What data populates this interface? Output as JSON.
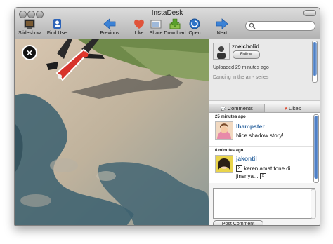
{
  "window": {
    "title": "InstaDesk"
  },
  "toolbar": {
    "buttons": [
      {
        "label": "Slideshow",
        "icon": "slideshow-icon"
      },
      {
        "label": "Find User",
        "icon": "find-user-icon"
      },
      {
        "label": "Previous",
        "icon": "previous-arrow-icon"
      },
      {
        "label": "Like",
        "icon": "heart-icon"
      },
      {
        "label": "Share",
        "icon": "share-icon"
      },
      {
        "label": "Download",
        "icon": "download-icon"
      },
      {
        "label": "Open",
        "icon": "open-icon"
      },
      {
        "label": "Next",
        "icon": "next-arrow-icon"
      }
    ],
    "search": {
      "icon": "search-icon",
      "value": ""
    }
  },
  "photo": {
    "close_icon": "close-icon"
  },
  "info": {
    "username": "zoelcholid",
    "follow_label": "Follow",
    "uploaded": "Uploaded 29 minutes ago",
    "caption": "Dancing in the air - series"
  },
  "tabs": {
    "comments": "Comments",
    "likes": "Likes"
  },
  "comments": [
    {
      "time": "25 minutes ago",
      "user": "lhampster",
      "text": "Nice shadow story!"
    },
    {
      "time": "6 minutes ago",
      "user": "jakontil",
      "text_before": "keren amat tone di jinsnya...",
      "box_glyph": "X"
    }
  ],
  "compose": {
    "value": "",
    "post_label": "Post Comment"
  },
  "colors": {
    "link": "#3a6ea5",
    "accent_blue": "#3f76c4",
    "like_red": "#e0533a"
  }
}
